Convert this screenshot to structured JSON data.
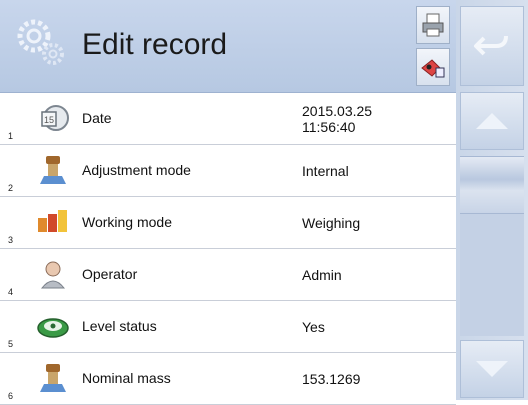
{
  "header": {
    "title": "Edit record",
    "logo_icon": "gears-icon",
    "action1_icon": "print-icon",
    "action2_icon": "export-icon"
  },
  "nav": {
    "back_icon": "back-arrow-icon",
    "up_icon": "scroll-up-icon",
    "down_icon": "scroll-down-icon"
  },
  "rows": [
    {
      "num": "1",
      "label": "Date",
      "value": "2015.03.25\n11:56:40",
      "icon": "calendar-clock-icon"
    },
    {
      "num": "2",
      "label": "Adjustment mode",
      "value": "Internal",
      "icon": "weight-adjust-icon"
    },
    {
      "num": "3",
      "label": "Working mode",
      "value": "Weighing",
      "icon": "working-mode-icon"
    },
    {
      "num": "4",
      "label": "Operator",
      "value": "Admin",
      "icon": "operator-icon"
    },
    {
      "num": "5",
      "label": "Level status",
      "value": "Yes",
      "icon": "level-icon"
    },
    {
      "num": "6",
      "label": "Nominal mass",
      "value": "153.1269",
      "icon": "nominal-mass-icon"
    }
  ]
}
